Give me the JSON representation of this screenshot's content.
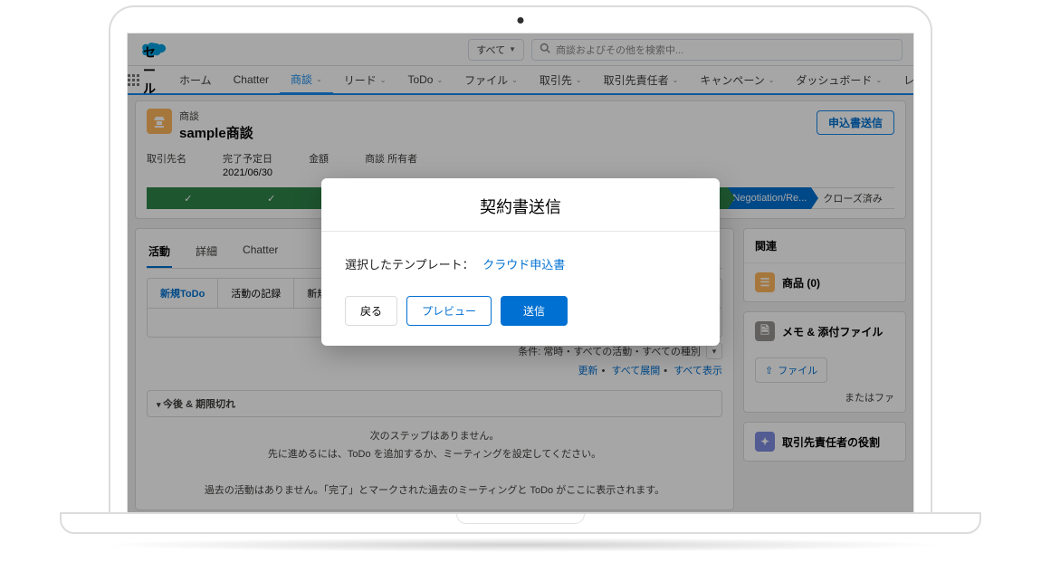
{
  "header": {
    "search_scope": "すべて",
    "search_placeholder": "商談およびその他を検索中..."
  },
  "nav": {
    "app_name": "セールス",
    "items": [
      "ホーム",
      "Chatter",
      "商談",
      "リード",
      "ToDo",
      "ファイル",
      "取引先",
      "取引先責任者",
      "キャンペーン",
      "ダッシュボード",
      "レポート"
    ],
    "active_index": 2
  },
  "record": {
    "object_label": "商談",
    "name": "sample商談",
    "action_button": "申込書送信",
    "fields": {
      "account_label": "取引先名",
      "account_value": "",
      "close_label": "完了予定日",
      "close_value": "2021/06/30",
      "amount_label": "金額",
      "amount_value": "",
      "owner_label": "商談 所有者",
      "owner_value": ""
    }
  },
  "path": {
    "current_blue": "Negotiation/Re...",
    "last": "クローズ済み"
  },
  "main": {
    "tabs": [
      "活動",
      "詳細",
      "Chatter"
    ],
    "active_tab": 0,
    "subtabs": [
      "新規ToDo",
      "活動の記録",
      "新規"
    ],
    "active_subtab": 0,
    "filter_text": "条件: 常時・すべての活動・すべての種別",
    "refresh": "更新",
    "expand_all": "すべて展開",
    "show_all": "すべて表示",
    "section": "今後 & 期限切れ",
    "empty_1": "次のステップはありません。",
    "empty_2": "先に進めるには、ToDo を追加するか、ミーティングを設定してください。",
    "past": "過去の活動はありません。「完了」とマークされた過去のミーティングと ToDo がここに表示されます。"
  },
  "side": {
    "related_title": "関連",
    "products": "商品 (0)",
    "notes": "メモ & 添付ファイル",
    "upload": "ファイル",
    "hint": "またはファ",
    "roles": "取引先責任者の役割"
  },
  "modal": {
    "title": "契約書送信",
    "template_label": "選択したテンプレート：",
    "template_name": "クラウド申込書",
    "back": "戻る",
    "preview": "プレビュー",
    "send": "送信"
  }
}
